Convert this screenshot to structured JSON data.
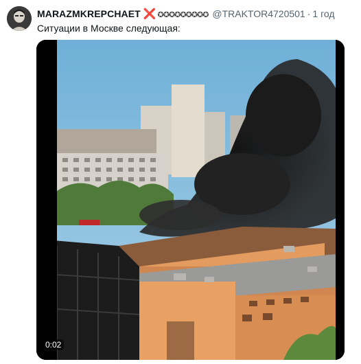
{
  "tweet": {
    "author": {
      "display_name": "MARAZMKREPCHAET",
      "badge": "❌",
      "emoji_tail": "✪✪✪✪✪✪✪✪✪",
      "handle": "@TRAKTOR4720501",
      "separator": "·",
      "time": "1 год"
    },
    "text": "Ситуации в Москве следующая:",
    "media": {
      "type": "video",
      "duration": "0:02",
      "description_icon": "play-video-icon"
    }
  },
  "colors": {
    "text": "#0f1419",
    "secondary": "#536471",
    "badge_red": "#d42b2b",
    "video_bg": "#000000"
  }
}
